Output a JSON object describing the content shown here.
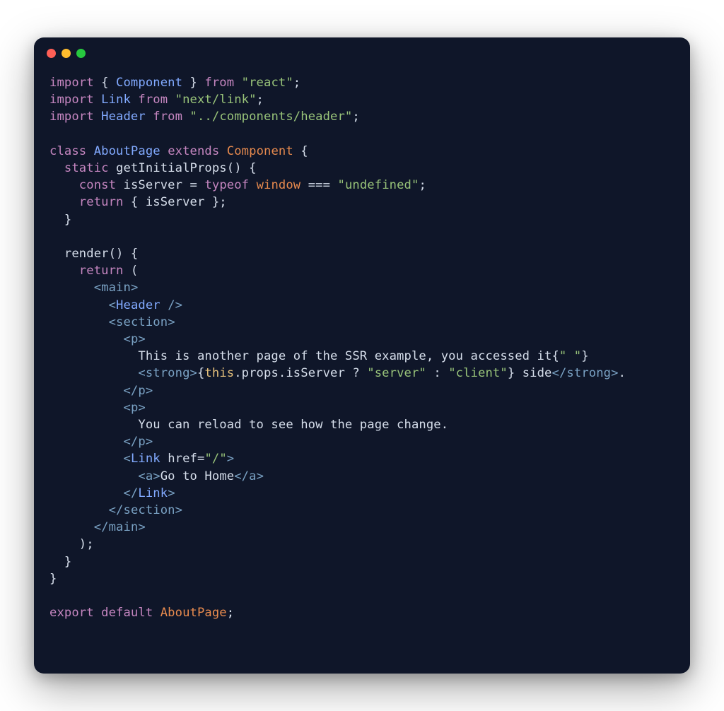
{
  "traffic_lights": [
    "red",
    "yellow",
    "green"
  ],
  "colors": {
    "background": "#0f1629",
    "keyword": "#c586c0",
    "class_blue": "#82aaff",
    "class_orange": "#e78a4e",
    "string": "#98c379",
    "variable": "#e78a4e",
    "this": "#e5c07b",
    "tag": "#7aa2c4",
    "text": "#d6deeb"
  },
  "code_tokens": {
    "l1": {
      "import": "import",
      "lbrace": " { ",
      "Component": "Component",
      "rbrace": " } ",
      "from": "from",
      "react": "\"react\"",
      "semi": ";"
    },
    "l2": {
      "import": "import",
      "Link": " Link ",
      "from": "from",
      "nextlink": " \"next/link\"",
      "semi": ";"
    },
    "l3": {
      "import": "import",
      "Header": " Header ",
      "from": "from",
      "path": " \"../components/header\"",
      "semi": ";"
    },
    "l5": {
      "class": "class",
      "AboutPage": " AboutPage ",
      "extends": "extends",
      "Component": " Component ",
      "lbrace": "{"
    },
    "l6": {
      "indent": "  ",
      "static": "static",
      "fn": " getInitialProps",
      "paren": "() {"
    },
    "l7": {
      "indent": "    ",
      "const": "const",
      "isServer": " isServer ",
      "eq": "= ",
      "typeof": "typeof",
      "window": " window ",
      "eqeq": "=== ",
      "undef": "\"undefined\"",
      "semi": ";"
    },
    "l8": {
      "indent": "    ",
      "return": "return",
      "rest": " { isServer };"
    },
    "l9": {
      "indent": "  ",
      "rbrace": "}"
    },
    "l11": {
      "indent": "  ",
      "render": "render",
      "paren": "() {"
    },
    "l12": {
      "indent": "    ",
      "return": "return",
      "paren": " ("
    },
    "l13": {
      "indent": "      ",
      "open": "<",
      "tag": "main",
      "close": ">"
    },
    "l14": {
      "indent": "        ",
      "open": "<",
      "tag": "Header ",
      "slash": "/>"
    },
    "l15": {
      "indent": "        ",
      "open": "<",
      "tag": "section",
      "close": ">"
    },
    "l16": {
      "indent": "          ",
      "open": "<",
      "tag": "p",
      "close": ">"
    },
    "l17": {
      "indent": "            ",
      "text": "This is another page of the SSR example, you accessed it",
      "jsxopen": "{",
      "str": "\" \"",
      "jsxclose": "}"
    },
    "l18": {
      "indent": "            ",
      "open": "<",
      "tag": "strong",
      "close": ">",
      "jsxopen": "{",
      "this": "this",
      "dot1": ".props.isServer ? ",
      "server": "\"server\"",
      "colon": " : ",
      "client": "\"client\"",
      "jsxclose": "}",
      "side": " side",
      "open2": "</",
      "tag2": "strong",
      "close2": ">",
      "dot2": "."
    },
    "l19": {
      "indent": "          ",
      "open": "</",
      "tag": "p",
      "close": ">"
    },
    "l20": {
      "indent": "          ",
      "open": "<",
      "tag": "p",
      "close": ">"
    },
    "l21": {
      "indent": "            ",
      "text": "You can reload to see how the page change."
    },
    "l22": {
      "indent": "          ",
      "open": "</",
      "tag": "p",
      "close": ">"
    },
    "l23": {
      "indent": "          ",
      "open": "<",
      "tag": "Link ",
      "attr": "href",
      "eq": "=",
      "val": "\"/\"",
      "close": ">"
    },
    "l24": {
      "indent": "            ",
      "open": "<",
      "tag": "a",
      "close": ">",
      "text": "Go to Home",
      "open2": "</",
      "tag2": "a",
      "close2": ">"
    },
    "l25": {
      "indent": "          ",
      "open": "</",
      "tag": "Link",
      "close": ">"
    },
    "l26": {
      "indent": "        ",
      "open": "</",
      "tag": "section",
      "close": ">"
    },
    "l27": {
      "indent": "      ",
      "open": "</",
      "tag": "main",
      "close": ">"
    },
    "l28": {
      "indent": "    ",
      "paren": ");"
    },
    "l29": {
      "indent": "  ",
      "rbrace": "}"
    },
    "l30": {
      "rbrace": "}"
    },
    "l32": {
      "export": "export",
      "default": " default",
      "AboutPage": " AboutPage",
      "semi": ";"
    }
  }
}
